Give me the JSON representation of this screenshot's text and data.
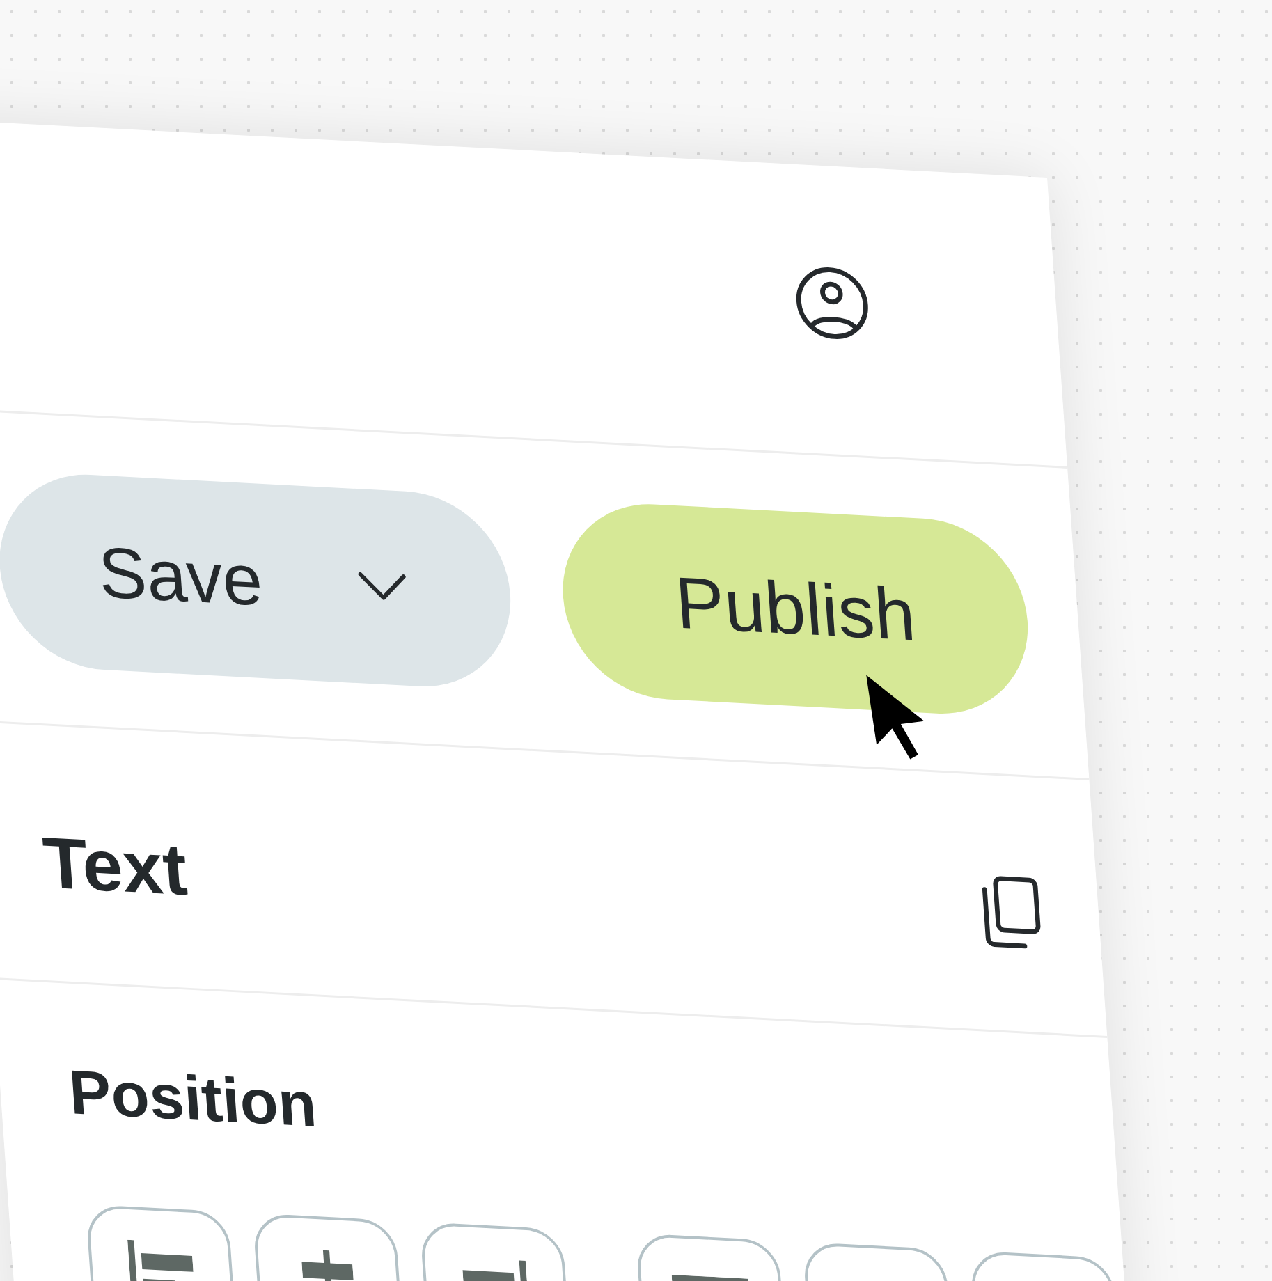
{
  "toolbar": {
    "buttons": [
      {
        "label": "Save",
        "kind": "dropdown"
      },
      {
        "label": "Publish",
        "kind": "primary"
      }
    ]
  },
  "sections": [
    {
      "title": "Text",
      "kind": "copy"
    },
    {
      "title": "Position",
      "kind": "alignment"
    }
  ]
}
